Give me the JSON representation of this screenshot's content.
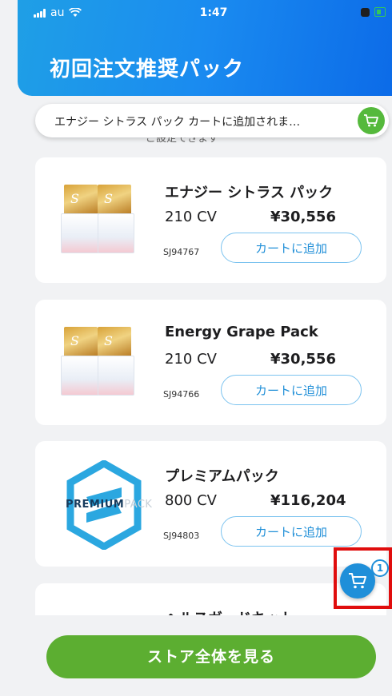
{
  "status_bar": {
    "carrier": "au",
    "time": "1:47"
  },
  "header": {
    "title": "初回注文推奨パック"
  },
  "notification": {
    "text": "エナジー シトラス パック  カートに追加されま…",
    "subtext": "ご設定できます"
  },
  "products": [
    {
      "name": "エナジー シトラス パック",
      "cv": "210 CV",
      "price": "¥30,556",
      "sku": "SJ94767",
      "add_label": "カートに追加"
    },
    {
      "name": "Energy Grape Pack",
      "cv": "210 CV",
      "price": "¥30,556",
      "sku": "SJ94766",
      "add_label": "カートに追加"
    },
    {
      "name": "プレミアムパック",
      "cv": "800 CV",
      "price": "¥116,204",
      "sku": "SJ94803",
      "add_label": "カートに追加",
      "logo_word": "PREMIUM",
      "logo_suffix": "PACK"
    },
    {
      "name": "ヘルスガードキット"
    }
  ],
  "cart": {
    "count": "1"
  },
  "footer": {
    "store_label": "ストア全体を見る"
  },
  "colors": {
    "header_start": "#1f9fe6",
    "header_end": "#0c6be8",
    "accent": "#2290d8",
    "success": "#55b93c",
    "store_button": "#5cae31",
    "highlight": "#e00d0d"
  }
}
